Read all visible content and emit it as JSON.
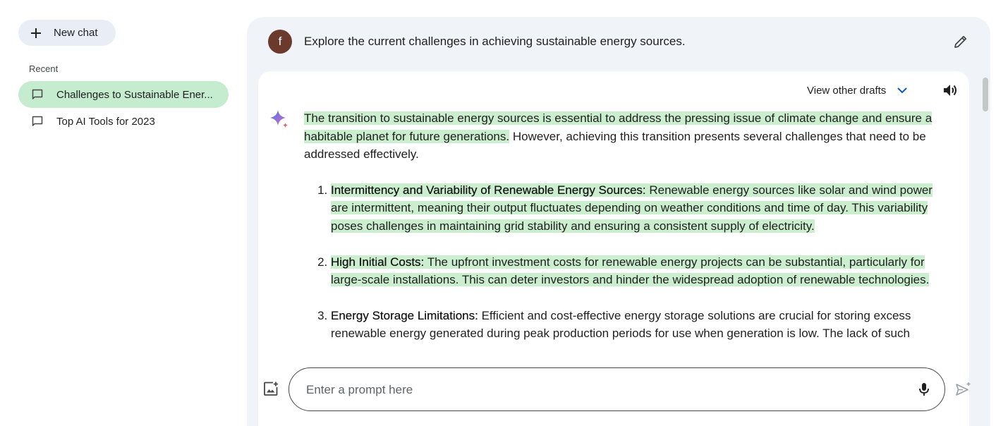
{
  "sidebar": {
    "new_chat_label": "New chat",
    "recent_label": "Recent",
    "items": [
      {
        "label": "Challenges to Sustainable Ener...",
        "active": true
      },
      {
        "label": "Top AI Tools for 2023",
        "active": false
      }
    ]
  },
  "conversation": {
    "user_initial": "f",
    "user_prompt": "Explore the current challenges in achieving sustainable energy sources.",
    "view_drafts_label": "View other drafts",
    "response": {
      "intro_highlight": "The transition to sustainable energy sources is essential to address the pressing issue of climate change and ensure a habitable planet for future generations.",
      "intro_rest": " However, achieving this transition presents several challenges that need to be addressed effectively.",
      "points": [
        {
          "title": "Intermittency and Variability of Renewable Energy Sources:",
          "text_a": " Renewable energy sources like solar and wind power are intermittent, meaning their output fluctuates depending on weather conditions and time of day.",
          "text_b": " This variability poses challenges in maintaining grid stability and ensuring a consistent supply of electricity."
        },
        {
          "title": "High Initial Costs:",
          "text_a": " The upfront investment costs for renewable energy projects can be substantial, particularly for large-scale installations.",
          "text_b": " This can deter investors and hinder the widespread adoption of renewable technologies."
        },
        {
          "title": "Energy Storage Limitations:",
          "text_a": " Efficient and cost-effective energy storage solutions are crucial for storing excess renewable energy generated during peak production periods for use when generation is low. The lack of such",
          "text_b": ""
        }
      ]
    }
  },
  "input": {
    "placeholder": "Enter a prompt here"
  },
  "colors": {
    "highlight": "#cbeecf",
    "active_item": "#c6ecd0",
    "panel_bg": "#f0f4f9",
    "accent_blue": "#0b57d0"
  }
}
